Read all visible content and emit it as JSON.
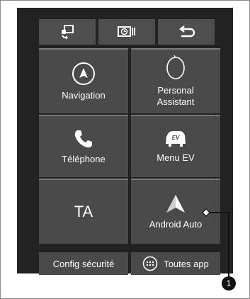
{
  "top_bar": {
    "buttons": [
      {
        "icon": "screen-swap-icon"
      },
      {
        "icon": "clock-toggle-icon"
      },
      {
        "icon": "back-arrow-icon"
      }
    ]
  },
  "tiles": [
    {
      "label": "Navigation",
      "icon": "navigation-compass-icon"
    },
    {
      "label": "Personal Assistant",
      "label_line1": "Personal",
      "label_line2": "Assistant",
      "icon": "assistant-icon"
    },
    {
      "label": "Téléphone",
      "icon": "phone-icon"
    },
    {
      "label": "Menu EV",
      "icon": "ev-car-icon"
    },
    {
      "label": "TA"
    },
    {
      "label": "Android Auto",
      "icon": "android-auto-icon"
    }
  ],
  "bottom_bar": {
    "config_label": "Config sécurité",
    "apps_label": "Toutes app",
    "apps_icon": "grid-dots-icon"
  },
  "callout": {
    "number": "1"
  },
  "colors": {
    "screen": "#222222",
    "tile": "#4a4a4a",
    "text": "#ffffff"
  }
}
